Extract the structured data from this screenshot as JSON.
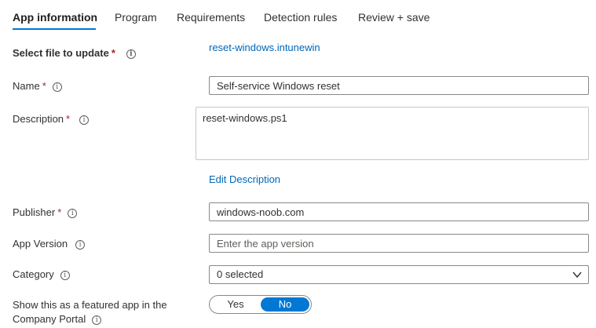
{
  "tabs": [
    {
      "label": "App information",
      "active": true
    },
    {
      "label": "Program"
    },
    {
      "label": "Requirements"
    },
    {
      "label": "Detection rules"
    },
    {
      "label": "Review + save"
    }
  ],
  "form": {
    "select_file": {
      "label": "Select file to update",
      "link": "reset-windows.intunewin"
    },
    "name": {
      "label": "Name",
      "value": "Self-service Windows reset"
    },
    "description": {
      "label": "Description",
      "value": "reset-windows.ps1",
      "edit_link": "Edit Description"
    },
    "publisher": {
      "label": "Publisher",
      "value": "windows-noob.com"
    },
    "app_version": {
      "label": "App Version",
      "value": "",
      "placeholder": "Enter the app version"
    },
    "category": {
      "label": "Category",
      "value": "0 selected"
    },
    "featured": {
      "label_line1": "Show this as a featured app in the",
      "label_line2": "Company Portal",
      "options": [
        "Yes",
        "No"
      ],
      "selected": "No"
    }
  },
  "required_marker": "*",
  "info_glyph": "i",
  "colors": {
    "accent": "#0078d4",
    "link": "#0067b8",
    "required": "#a4262c"
  }
}
